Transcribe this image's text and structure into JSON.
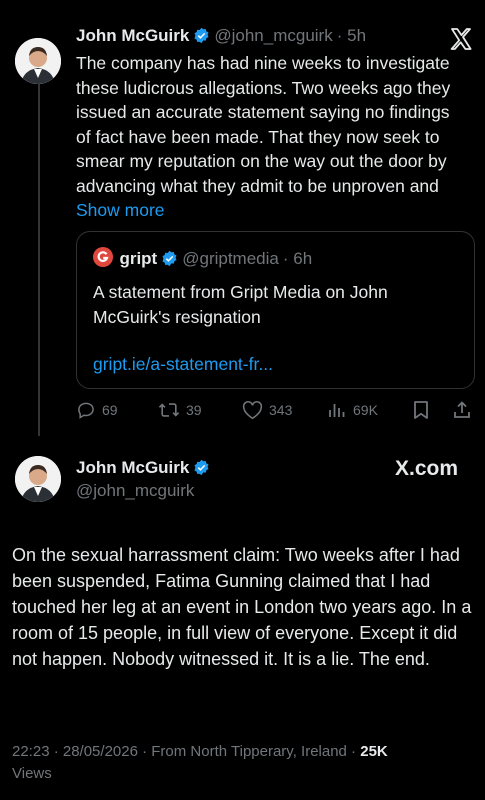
{
  "colors": {
    "background": "#000000",
    "text": "#e7e9ea",
    "muted": "#71767b",
    "link": "#1d9bf0",
    "verified": "#1d9bf0",
    "border": "#2f3336",
    "gript_logo": "#e0483e"
  },
  "tweet1": {
    "author_name": "John McGuirk",
    "handle": "@john_mcguirk",
    "time": "· 5h",
    "text": "The company has had nine weeks to investigate these ludicrous allegations. Two weeks ago they issued an accurate statement saying no findings of fact have been made. That they now seek to smear my reputation on the way out the door by advancing what they admit to be unproven and",
    "show_more": "Show more",
    "quote": {
      "logo_icon": "gript-logo-icon",
      "name": "gript",
      "handle": "@griptmedia",
      "time": "· 6h",
      "text": "A statement from Gript Media on John McGuirk's resignation",
      "link": "gript.ie/a-statement-fr..."
    },
    "actions": {
      "replies": "69",
      "reposts": "39",
      "likes": "343",
      "views": "69K"
    }
  },
  "tweet2": {
    "author_name": "John McGuirk",
    "handle": "@john_mcguirk",
    "text": "On the sexual harrassment claim: Two weeks after I had been suspended, Fatima Gunning claimed that I had touched her leg at an event in London two years ago. In a room of 15 people, in full view of everyone. Except it did not happen. Nobody witnessed it. It is a lie. The end.",
    "meta_line": "22:23 · 28/05/2026 · From North Tipperary, Ireland ·",
    "views_count": "25K",
    "views_label": "Views"
  },
  "brand_top": "X-logo-icon",
  "brand_bottom": "X.com"
}
